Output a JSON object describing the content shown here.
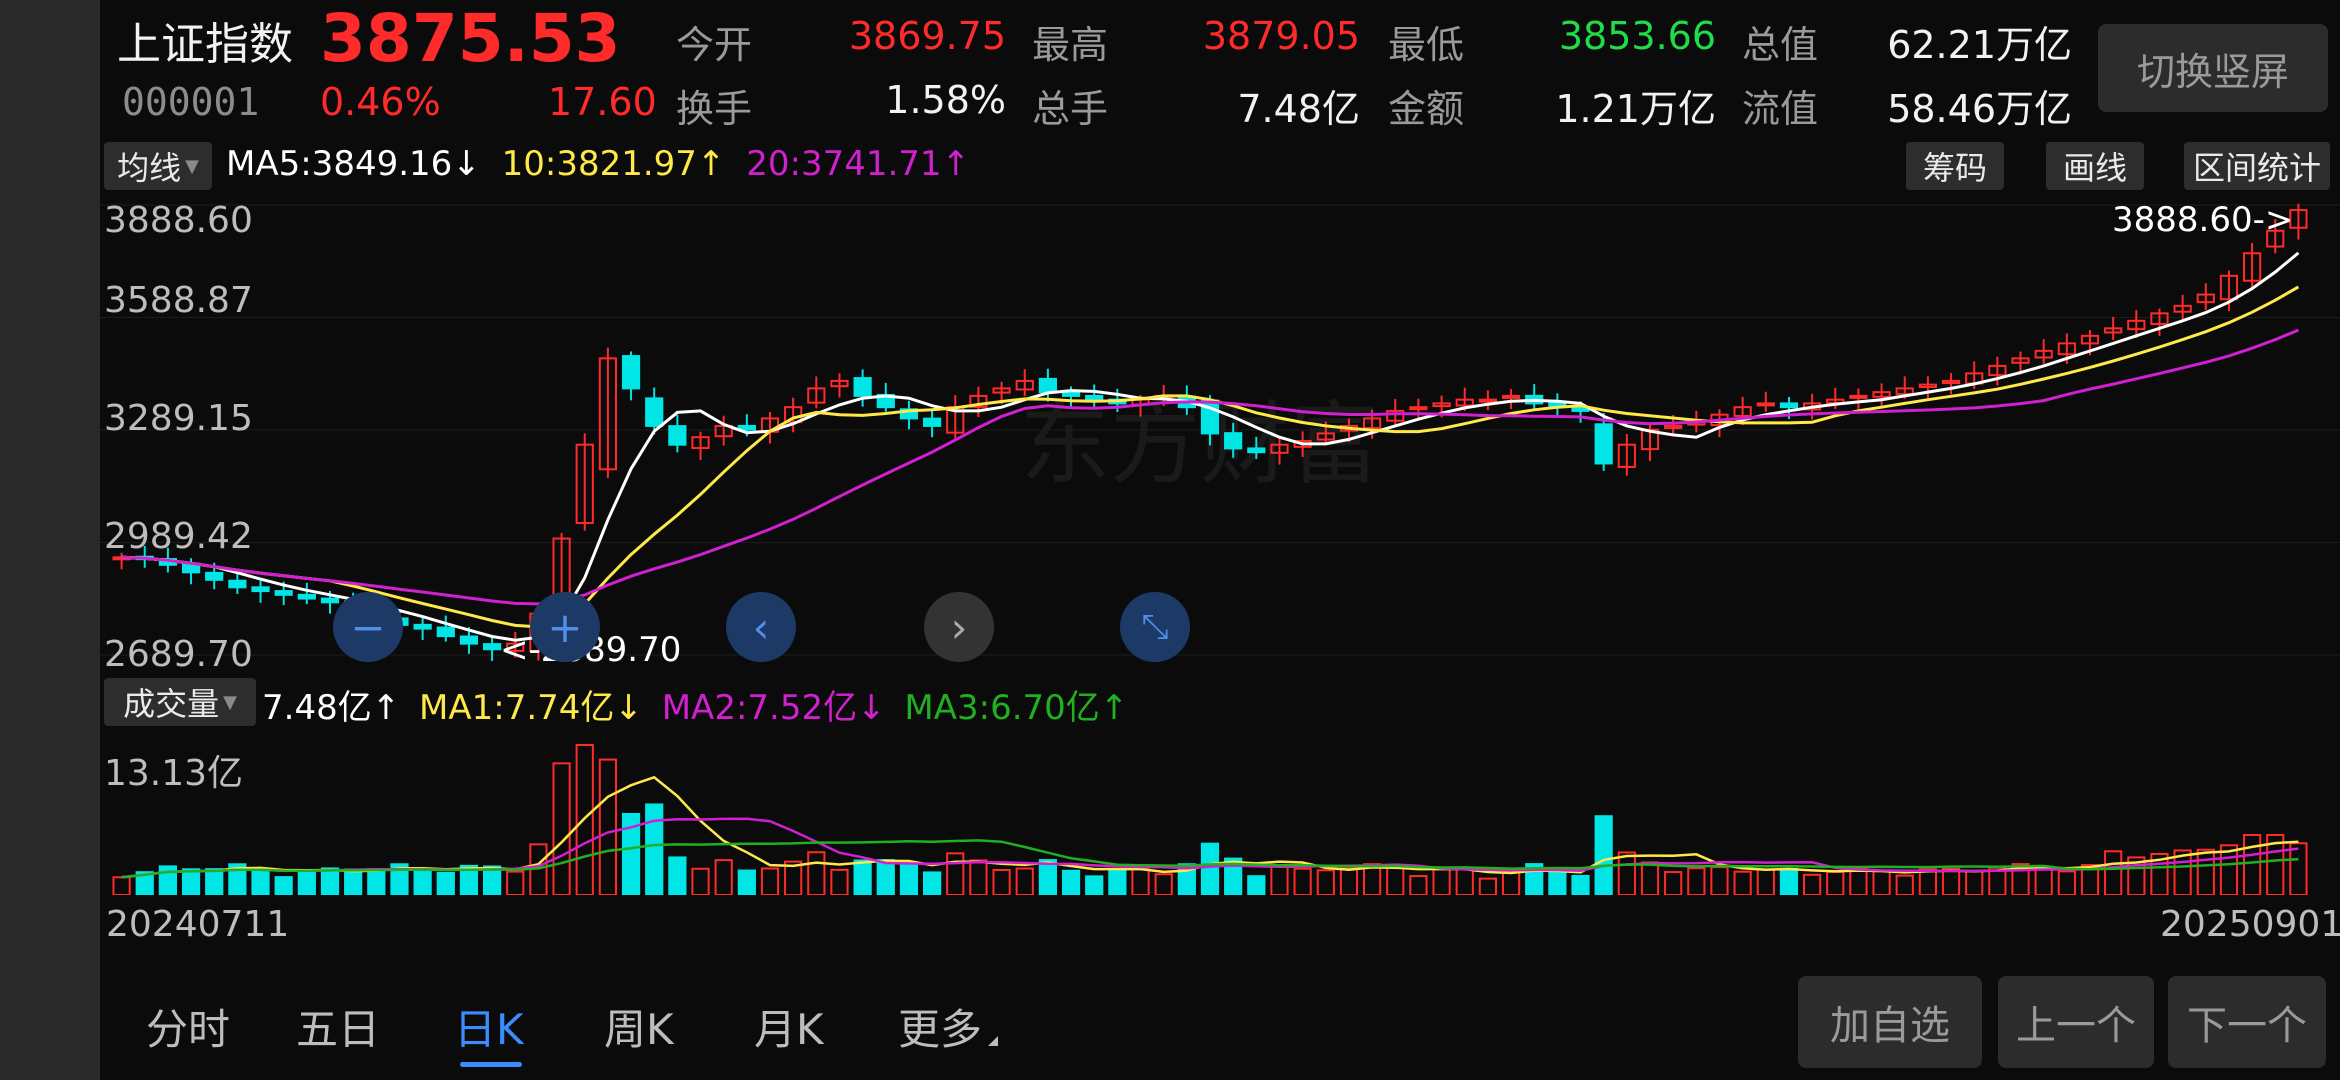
{
  "header": {
    "index_name": "上证指数",
    "price": "3875.53",
    "code": "000001",
    "pct_change": "0.46%",
    "point_change": "17.60",
    "stats": [
      {
        "label": "今开",
        "value": "3869.75",
        "color": "red"
      },
      {
        "label": "最高",
        "value": "3879.05",
        "color": "red"
      },
      {
        "label": "最低",
        "value": "3853.66",
        "color": "green"
      },
      {
        "label": "总值",
        "value": "62.21万亿",
        "color": "white"
      },
      {
        "label": "换手",
        "value": "1.58%",
        "color": "white"
      },
      {
        "label": "总手",
        "value": "7.48亿",
        "color": "white"
      },
      {
        "label": "金额",
        "value": "1.21万亿",
        "color": "white"
      },
      {
        "label": "流值",
        "value": "58.46万亿",
        "color": "white"
      }
    ],
    "switch_button": "切换竖屏"
  },
  "ma_bar": {
    "selector": "均线",
    "ma5": "MA5:3849.16",
    "ma5_arrow": "↓",
    "ma10": "10:3821.97",
    "ma10_arrow": "↑",
    "ma20": "20:3741.71",
    "ma20_arrow": "↑",
    "buttons": [
      "筹码",
      "画线",
      "区间统计"
    ]
  },
  "price_chart": {
    "y_labels": [
      "3888.60",
      "3588.87",
      "3289.15",
      "2989.42",
      "2689.70"
    ],
    "high_marker": "3888.60->",
    "low_marker": "<-2689.70",
    "watermark": "东方财富"
  },
  "volume_bar": {
    "selector": "成交量",
    "vol": "7.48亿",
    "vol_arrow": "↑",
    "ma1": "MA1:7.74亿",
    "ma1_arrow": "↓",
    "ma2": "MA2:7.52亿",
    "ma2_arrow": "↓",
    "ma3": "MA3:6.70亿",
    "ma3_arrow": "↑",
    "max_label": "13.13亿"
  },
  "date_range": {
    "start": "20240711",
    "end": "20250901"
  },
  "tabs": [
    "分时",
    "五日",
    "日K",
    "周K",
    "月K",
    "更多"
  ],
  "active_tab": "日K",
  "actions": [
    "加自选",
    "上一个",
    "下一个"
  ],
  "colors": {
    "up": "#ff2b2b",
    "down": "#00e5e5",
    "ma5": "#ffffff",
    "ma10": "#ffe84a",
    "ma20": "#d020d0",
    "ma3": "#20b020",
    "accent": "#3b8cff"
  },
  "chart_data": {
    "type": "candlestick",
    "y_range": [
      2689.7,
      3888.6
    ],
    "close_series_approx": [
      2950,
      2945,
      2930,
      2910,
      2890,
      2870,
      2860,
      2850,
      2840,
      2830,
      2810,
      2790,
      2770,
      2760,
      2740,
      2720,
      2705,
      2720,
      2800,
      3000,
      3250,
      3480,
      3400,
      3300,
      3250,
      3270,
      3300,
      3290,
      3320,
      3350,
      3400,
      3420,
      3380,
      3350,
      3320,
      3300,
      3350,
      3380,
      3400,
      3420,
      3390,
      3380,
      3370,
      3360,
      3370,
      3380,
      3350,
      3280,
      3240,
      3230,
      3250,
      3260,
      3280,
      3300,
      3320,
      3340,
      3350,
      3360,
      3370,
      3370,
      3380,
      3360,
      3350,
      3340,
      3200,
      3250,
      3290,
      3300,
      3310,
      3330,
      3350,
      3360,
      3350,
      3360,
      3370,
      3380,
      3390,
      3400,
      3410,
      3420,
      3440,
      3460,
      3480,
      3500,
      3520,
      3540,
      3560,
      3580,
      3600,
      3620,
      3650,
      3700,
      3760,
      3820,
      3875
    ]
  }
}
